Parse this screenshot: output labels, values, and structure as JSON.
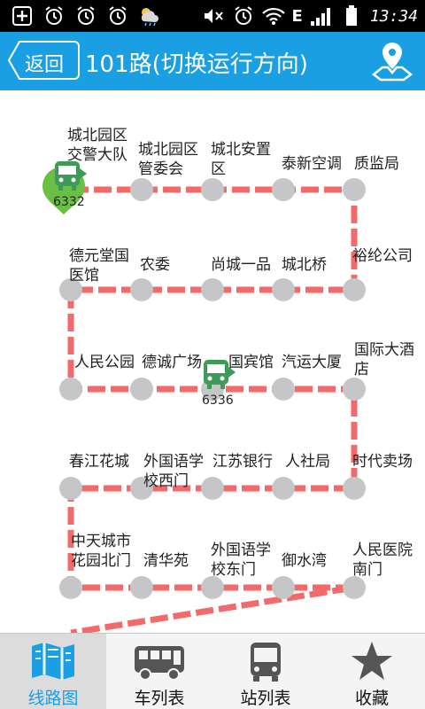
{
  "statusbar": {
    "time": "13:34",
    "network": "E"
  },
  "header": {
    "back_label": "返回",
    "title": "101路(切换运行方向)"
  },
  "stops": [
    {
      "name": "城北园区\n交警大队"
    },
    {
      "name": "城北园区\n管委会"
    },
    {
      "name": "城北安置\n区"
    },
    {
      "name": "泰新空调"
    },
    {
      "name": "质监局"
    },
    {
      "name": "德元堂国\n医馆"
    },
    {
      "name": "农委"
    },
    {
      "name": "尚城一品"
    },
    {
      "name": "城北桥"
    },
    {
      "name": "裕纶公司"
    },
    {
      "name": "人民公园"
    },
    {
      "name": "德诚广场"
    },
    {
      "name": "国宾馆"
    },
    {
      "name": "汽运大厦"
    },
    {
      "name": "国际大酒\n店"
    },
    {
      "name": "春江花城"
    },
    {
      "name": "外国语学\n校西门"
    },
    {
      "name": "江苏银行"
    },
    {
      "name": "人社局"
    },
    {
      "name": "时代卖场"
    },
    {
      "name": "中天城市\n花园北门"
    },
    {
      "name": "清华苑"
    },
    {
      "name": "外国语学\n校东门"
    },
    {
      "name": "御水湾"
    },
    {
      "name": "人民医院\n南门"
    }
  ],
  "buses": [
    {
      "number": "6332"
    },
    {
      "number": "6336"
    }
  ],
  "tabs": [
    {
      "label": "线路图",
      "icon": "map-icon",
      "active": true
    },
    {
      "label": "车列表",
      "icon": "bus-side-icon",
      "active": false
    },
    {
      "label": "站列表",
      "icon": "bus-front-icon",
      "active": false
    },
    {
      "label": "收藏",
      "icon": "star-icon",
      "active": false
    }
  ],
  "colors": {
    "accent": "#1a9fe3",
    "route": "#f26a6a",
    "stop": "#c4c6c8",
    "bus": "#3e9b57",
    "marker": "#6cbf45"
  }
}
